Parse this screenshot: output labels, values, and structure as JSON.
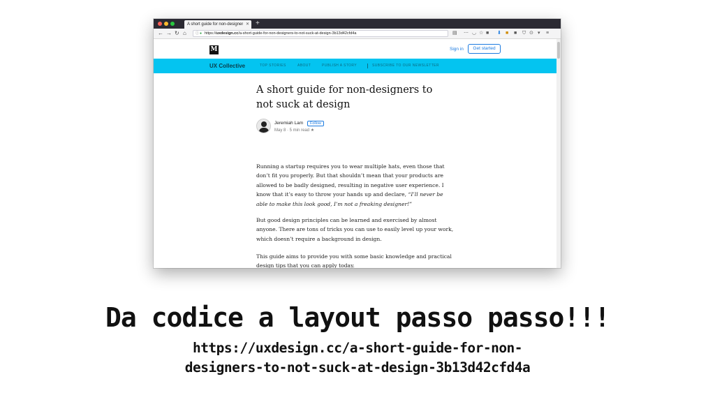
{
  "browser": {
    "tab_title": "A short guide for non-designers",
    "new_tab": "+",
    "url_prefix": "https://",
    "url_host": "uxdesign.cc",
    "url_path": "/a-short-guide-for-non-designers-to-not-suck-at-design-3b13d42cfd4a"
  },
  "site": {
    "logo": "M",
    "signin": "Sign in",
    "get_started": "Get started"
  },
  "publication": {
    "name": "UX Collective",
    "links": [
      "TOP STORIES",
      "ABOUT",
      "PUBLISH A STORY",
      "SUBSCRIBE TO OUR NEWSLETTER"
    ],
    "color": "#04c4f0"
  },
  "article": {
    "title": "A short guide for non-designers to not suck at design",
    "author": "Jeremiah Lam",
    "follow_label": "Follow",
    "meta": "May 8 · 5 min read",
    "paragraphs": [
      "Running a startup requires you to wear multiple hats, even those that don’t fit you properly. But that shouldn’t mean that your products are allowed to be badly designed, resulting in negative user experience. I know that it’s easy to throw your hands up and declare, ",
      "But good design principles can be learned and exercised by almost anyone. There are tons of tricks you can use to easily level up your work, which doesn’t require a background in design.",
      "This guide aims to provide you with some basic knowledge and practical design tips that you can apply today."
    ],
    "quote": "“I’ll never be able to make this look good, I’m not a freaking designer!”"
  },
  "slide": {
    "title": "Da codice a layout passo passo!!!",
    "url_line1": "https://uxdesign.cc/a-short-guide-for-non-",
    "url_line2": "designers-to-not-suck-at-design-3b13d42cfd4a"
  }
}
